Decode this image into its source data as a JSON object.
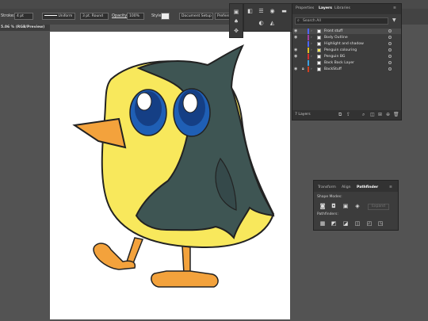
{
  "control_bar": {
    "stroke_label": "Stroke:",
    "stroke_weight": "4 pt",
    "stroke_profile": "Uniform",
    "brush": "3 pt. Round",
    "opacity_label": "Opacity:",
    "opacity_value": "100%",
    "style_label": "Style:",
    "document_setup": "Document Setup",
    "preferences": "Preferen"
  },
  "document": {
    "tab_title": "5.06 % (RGB/Preview)"
  },
  "layers_panel": {
    "tabs": [
      "Properties",
      "Layers",
      "Libraries"
    ],
    "active_tab": "Layers",
    "search_placeholder": "Search All",
    "layers": [
      {
        "name": "Front stuff",
        "color": "#4d66ff",
        "visible": true,
        "locked": false
      },
      {
        "name": "Body Outline",
        "color": "#a040a0",
        "visible": true,
        "locked": false
      },
      {
        "name": "Highlight and shadow",
        "color": "#4d66ff",
        "visible": false,
        "locked": false
      },
      {
        "name": "Penguin colouring",
        "color": "#e0c020",
        "visible": true,
        "locked": false
      },
      {
        "name": "Penguin BG",
        "color": "#d03030",
        "visible": true,
        "locked": false
      },
      {
        "name": "Back Back Layer",
        "color": "#40a0e0",
        "visible": false,
        "locked": false
      },
      {
        "name": "BackStuff",
        "color": "#d04020",
        "visible": true,
        "locked": true
      }
    ],
    "footer_count": "7 Layers"
  },
  "pathfinder_panel": {
    "tabs": [
      "Transform",
      "Align",
      "Pathfinder"
    ],
    "active_tab": "Pathfinder",
    "shape_modes_label": "Shape Modes:",
    "pathfinders_label": "Pathfinders:",
    "expand_label": "Expand"
  },
  "colors": {
    "penguin_yellow": "#f8e85c",
    "penguin_dark": "#3e5553",
    "beak_orange": "#f3a23c",
    "eye_blue": "#1f5fb5"
  }
}
